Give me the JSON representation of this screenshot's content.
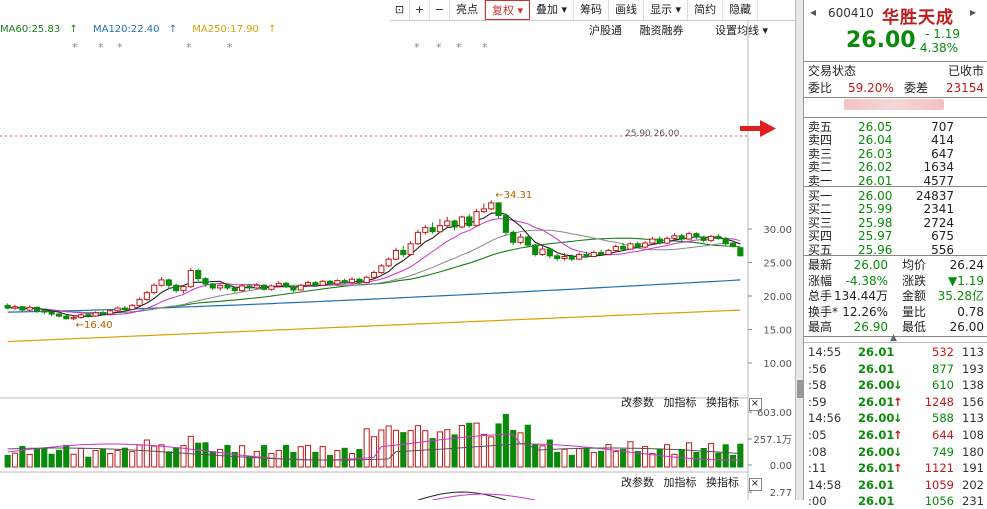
{
  "toolbar": {
    "items": [
      "亮点",
      "复权",
      "叠加",
      "筹码",
      "画线",
      "显示",
      "简约",
      "隐藏"
    ],
    "selected": "复权"
  },
  "ma_legend": [
    {
      "label": "MA60:25.83",
      "color": "#1a7a1a"
    },
    {
      "label": "MA120:22.40",
      "color": "#1f6fb3"
    },
    {
      "label": "MA250:17.90",
      "color": "#d8a000"
    }
  ],
  "chart_menu": [
    "沪股通",
    "融资融券",
    "设置均线"
  ],
  "chart_data": {
    "type": "candlestick",
    "price_axis": {
      "ticks": [
        30.0,
        25.0,
        20.0,
        15.0,
        10.0
      ]
    },
    "high_label": "34.31",
    "low_label": "16.40",
    "mid_label": "25.90 26.00",
    "candles": [
      [
        18.6,
        18.2,
        18.9,
        18.0
      ],
      [
        18.2,
        18.4,
        18.7,
        17.9
      ],
      [
        18.4,
        17.9,
        18.5,
        17.7
      ],
      [
        17.9,
        18.3,
        18.6,
        17.6
      ],
      [
        18.3,
        17.8,
        18.4,
        17.5
      ],
      [
        17.8,
        17.6,
        18.0,
        17.3
      ],
      [
        17.6,
        17.3,
        17.8,
        17.0
      ],
      [
        17.3,
        17.0,
        17.5,
        16.8
      ],
      [
        17.0,
        16.6,
        17.2,
        16.5
      ],
      [
        16.6,
        16.8,
        17.0,
        16.4
      ],
      [
        16.8,
        17.2,
        17.4,
        16.6
      ],
      [
        17.2,
        17.0,
        17.5,
        16.8
      ],
      [
        17.0,
        17.5,
        17.7,
        16.9
      ],
      [
        17.5,
        17.3,
        17.8,
        17.1
      ],
      [
        17.3,
        17.8,
        18.0,
        17.2
      ],
      [
        17.8,
        18.2,
        18.4,
        17.6
      ],
      [
        18.2,
        18.0,
        18.5,
        17.8
      ],
      [
        18.0,
        18.6,
        18.8,
        17.9
      ],
      [
        18.6,
        19.5,
        19.8,
        18.5
      ],
      [
        19.5,
        20.5,
        20.8,
        19.3
      ],
      [
        20.5,
        21.6,
        21.9,
        20.3
      ],
      [
        21.6,
        22.4,
        22.8,
        21.4
      ],
      [
        22.4,
        21.6,
        22.6,
        21.0
      ],
      [
        21.6,
        20.8,
        21.8,
        20.5
      ],
      [
        20.8,
        21.4,
        21.6,
        20.4
      ],
      [
        21.4,
        23.8,
        24.2,
        21.2
      ],
      [
        23.8,
        22.6,
        24.0,
        22.2
      ],
      [
        22.6,
        21.8,
        22.8,
        21.4
      ],
      [
        21.8,
        21.2,
        22.0,
        20.9
      ],
      [
        21.2,
        21.6,
        21.9,
        20.8
      ],
      [
        21.6,
        21.2,
        21.8,
        20.9
      ],
      [
        21.2,
        20.8,
        21.4,
        20.5
      ],
      [
        20.8,
        21.5,
        21.8,
        20.6
      ],
      [
        21.5,
        21.2,
        21.7,
        20.9
      ],
      [
        21.2,
        21.6,
        21.9,
        21.0
      ],
      [
        21.6,
        21.0,
        21.8,
        20.8
      ],
      [
        21.0,
        21.5,
        21.7,
        20.8
      ],
      [
        21.5,
        21.9,
        22.2,
        21.3
      ],
      [
        21.9,
        21.4,
        22.1,
        21.2
      ],
      [
        21.4,
        20.9,
        21.6,
        20.6
      ],
      [
        20.9,
        21.6,
        21.8,
        20.8
      ],
      [
        21.6,
        22.0,
        22.3,
        21.4
      ],
      [
        22.0,
        21.6,
        22.2,
        21.4
      ],
      [
        21.6,
        22.2,
        22.4,
        21.5
      ],
      [
        22.2,
        21.8,
        22.4,
        21.6
      ],
      [
        21.8,
        22.3,
        22.5,
        21.6
      ],
      [
        22.3,
        22.0,
        22.6,
        21.8
      ],
      [
        22.0,
        22.5,
        22.8,
        21.9
      ],
      [
        22.5,
        22.0,
        22.7,
        21.8
      ],
      [
        22.0,
        22.8,
        23.0,
        21.9
      ],
      [
        22.8,
        23.5,
        23.8,
        22.6
      ],
      [
        23.5,
        24.5,
        24.8,
        23.3
      ],
      [
        24.5,
        25.5,
        25.8,
        24.3
      ],
      [
        25.5,
        26.8,
        27.2,
        25.3
      ],
      [
        26.8,
        26.2,
        27.5,
        25.8
      ],
      [
        26.2,
        27.8,
        28.2,
        26.0
      ],
      [
        27.8,
        29.5,
        29.9,
        27.6
      ],
      [
        29.5,
        30.2,
        30.6,
        29.2
      ],
      [
        30.2,
        29.6,
        31.0,
        29.3
      ],
      [
        29.6,
        30.5,
        31.5,
        29.4
      ],
      [
        30.5,
        31.2,
        31.8,
        30.3
      ],
      [
        31.2,
        30.3,
        31.4,
        29.8
      ],
      [
        30.3,
        31.8,
        32.0,
        30.1
      ],
      [
        31.8,
        30.5,
        32.2,
        30.2
      ],
      [
        30.5,
        32.6,
        33.0,
        30.4
      ],
      [
        32.6,
        33.0,
        33.8,
        32.3
      ],
      [
        33.0,
        33.9,
        34.3,
        32.8
      ],
      [
        33.9,
        32.0,
        34.0,
        31.6
      ],
      [
        32.0,
        29.5,
        32.2,
        29.0
      ],
      [
        29.5,
        28.0,
        29.8,
        27.6
      ],
      [
        28.0,
        28.8,
        29.3,
        27.7
      ],
      [
        28.8,
        27.6,
        29.0,
        27.3
      ],
      [
        27.6,
        26.2,
        27.8,
        25.9
      ],
      [
        26.2,
        27.0,
        27.4,
        26.0
      ],
      [
        27.0,
        26.0,
        27.1,
        25.6
      ],
      [
        26.0,
        25.6,
        26.3,
        25.2
      ],
      [
        25.6,
        25.9,
        26.4,
        25.3
      ],
      [
        25.9,
        25.5,
        26.2,
        25.2
      ],
      [
        25.5,
        26.2,
        26.5,
        25.4
      ],
      [
        26.2,
        25.9,
        26.6,
        25.7
      ],
      [
        25.9,
        26.5,
        26.8,
        25.8
      ],
      [
        26.5,
        26.2,
        26.9,
        26.0
      ],
      [
        26.2,
        26.8,
        27.0,
        26.1
      ],
      [
        26.8,
        27.4,
        27.7,
        26.6
      ],
      [
        27.4,
        27.0,
        27.9,
        26.8
      ],
      [
        27.0,
        27.8,
        28.0,
        26.9
      ],
      [
        27.8,
        27.3,
        28.1,
        27.1
      ],
      [
        27.3,
        27.9,
        28.2,
        27.1
      ],
      [
        27.9,
        28.5,
        28.8,
        27.8
      ],
      [
        28.5,
        27.9,
        28.9,
        27.7
      ],
      [
        27.9,
        28.6,
        28.9,
        27.8
      ],
      [
        28.6,
        29.0,
        29.4,
        28.4
      ],
      [
        29.0,
        28.5,
        29.3,
        28.2
      ],
      [
        28.5,
        29.3,
        29.6,
        28.4
      ],
      [
        29.3,
        28.8,
        29.5,
        28.5
      ],
      [
        28.8,
        28.3,
        29.0,
        28.0
      ],
      [
        28.3,
        28.9,
        29.1,
        28.1
      ],
      [
        28.9,
        28.6,
        29.2,
        28.4
      ],
      [
        28.6,
        27.8,
        28.8,
        27.5
      ],
      [
        27.8,
        27.4,
        28.1,
        27.2
      ],
      [
        27.2,
        26.0,
        27.3,
        25.9
      ]
    ],
    "volume_axis": {
      "ticks": [
        "603.00",
        "257.1万",
        "0.00"
      ]
    },
    "indicator_axis": {
      "ticks": [
        "2.77"
      ]
    }
  },
  "panel_header": {
    "code": "600410",
    "name": "华胜天成",
    "price": "26.00",
    "change": "- 1.19",
    "pct": "- 4.38%"
  },
  "status": {
    "label": "交易状态",
    "value": "已收市"
  },
  "weibi": {
    "label1": "委比",
    "val1": "59.20%",
    "label2": "委差",
    "val2": "23154"
  },
  "sell_orders": [
    {
      "label": "卖五",
      "price": "26.05",
      "vol": "707"
    },
    {
      "label": "卖四",
      "price": "26.04",
      "vol": "414"
    },
    {
      "label": "卖三",
      "price": "26.03",
      "vol": "647"
    },
    {
      "label": "卖二",
      "price": "26.02",
      "vol": "1634"
    },
    {
      "label": "卖一",
      "price": "26.01",
      "vol": "4577"
    }
  ],
  "buy_orders": [
    {
      "label": "买一",
      "price": "26.00",
      "vol": "24837"
    },
    {
      "label": "买二",
      "price": "25.99",
      "vol": "2341"
    },
    {
      "label": "买三",
      "price": "25.98",
      "vol": "2724"
    },
    {
      "label": "买四",
      "price": "25.97",
      "vol": "675"
    },
    {
      "label": "买五",
      "price": "25.96",
      "vol": "556"
    }
  ],
  "stats": [
    {
      "l1": "最新",
      "v1": "26.00",
      "l2": "均价",
      "v2": "26.24"
    },
    {
      "l1": "涨幅",
      "v1": "-4.38%",
      "l2": "涨跌",
      "v2": "▼1.19"
    },
    {
      "l1": "总手",
      "v1": "134.44万",
      "l2": "金额",
      "v2": "35.28亿"
    },
    {
      "l1": "换手*",
      "v1": "12.26%",
      "l2": "量比",
      "v2": "0.78"
    },
    {
      "l1": "最高",
      "v1": "26.90",
      "l2": "最低",
      "v2": "26.00"
    }
  ],
  "ticks": [
    {
      "time": "14:55",
      "price": "26.01",
      "arrow": "",
      "vol": "532",
      "n": "113"
    },
    {
      "time": ":56",
      "price": "26.01",
      "arrow": "",
      "vol": "877",
      "n": "193"
    },
    {
      "time": ":58",
      "price": "26.00",
      "arrow": "↓",
      "vol": "610",
      "n": "138"
    },
    {
      "time": ":59",
      "price": "26.01",
      "arrow": "↑",
      "vol": "1248",
      "n": "156"
    },
    {
      "time": "14:56",
      "price": "26.00",
      "arrow": "↓",
      "vol": "588",
      "n": "113"
    },
    {
      "time": ":05",
      "price": "26.01",
      "arrow": "↑",
      "vol": "644",
      "n": "108"
    },
    {
      "time": ":08",
      "price": "26.00",
      "arrow": "↓",
      "vol": "749",
      "n": "180"
    },
    {
      "time": ":11",
      "price": "26.01",
      "arrow": "↑",
      "vol": "1121",
      "n": "191"
    },
    {
      "time": "14:58",
      "price": "26.01",
      "arrow": "",
      "vol": "1059",
      "n": "202"
    },
    {
      "time": ":00",
      "price": "26.01",
      "arrow": "",
      "vol": "1056",
      "n": "231"
    }
  ],
  "sub_menu": [
    "改参数",
    "加指标",
    "换指标"
  ],
  "stars": "*",
  "closebox": "×",
  "toolbar_icons": {
    "left": "◂",
    "right": "▸",
    "plus": "+",
    "minus": "−"
  },
  "colors": {
    "up": "#c01a1a",
    "down": "#0a8a0a",
    "ma5": "#222222",
    "ma10": "#cc33cc",
    "ma20": "#888888",
    "ma60": "#1a7a1a",
    "ma120": "#1f6fb3",
    "ma250": "#d8a000"
  }
}
